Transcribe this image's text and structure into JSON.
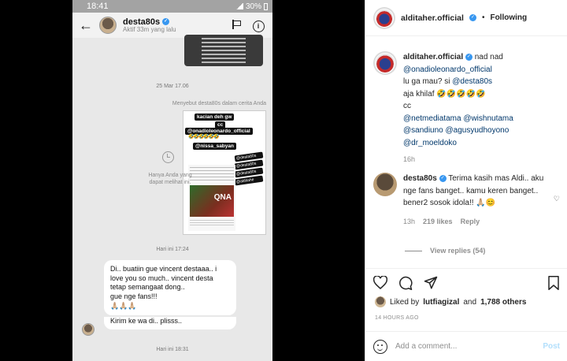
{
  "phone": {
    "time": "18:41",
    "battery": "30%",
    "dm_user": "desta80s",
    "dm_active": "Aktif 33m yang lalu",
    "stamp_1": "25 Mar 17.06",
    "mention_caption": "Menyebut desta80s dalam cerita Anda",
    "only_you": "Hanya Anda yang dapat melihat ini.",
    "story_tags": [
      "kacian deh gw",
      "cc",
      "@onadioleonardo_official",
      "@nissa_sabyan"
    ],
    "story_emoji": "🤣🤣🤣🤣🤣🤣",
    "story_side_tags": [
      "@desta80s",
      "@desta80s",
      "@desta80s",
      "@alditahe"
    ],
    "story_image_text": "QNA",
    "stamp_2": "Hari ini 17:24",
    "message_lines": [
      "Di.. buatiin gue vincent destaaa.. i",
      "love you so much.. vincent desta",
      "tetap semangaat dong..",
      "gue nge fans!!!"
    ],
    "message_hands": "🙏🏼🙏🏼🙏🏼",
    "message_2": "Kirim ke wa di.. plisss..",
    "stamp_3": "Hari ini 18:31"
  },
  "ig": {
    "post_user": "alditaher.official",
    "following": "Following",
    "caption": {
      "user": "alditaher.official",
      "line1": "nad nad",
      "mention1": "@onadioleonardo_official",
      "line2": "lu ga mau? si",
      "mention2": "@desta80s",
      "line3": "aja khilaf 🤣🤣🤣🤣🤣",
      "cc": "cc",
      "mentions": [
        "@netmediatama",
        "@wishnutama",
        "@sandiuno",
        "@agusyudhoyono",
        "@dr_moeldoko"
      ],
      "time": "16h"
    },
    "comment": {
      "user": "desta80s",
      "text": "Terima kasih mas Aldi.. aku nge fans banget.. kamu keren banget.. bener2 sosok idola!! 🙏🏼😊",
      "time": "13h",
      "likes": "219 likes",
      "reply": "Reply"
    },
    "view_replies": "View replies (54)",
    "liked_by_prefix": "Liked by",
    "liked_by_user": "lutfiagizal",
    "liked_by_and": "and",
    "liked_by_count": "1,788 others",
    "ago": "14 HOURS AGO",
    "add_comment_placeholder": "Add a comment...",
    "post_button": "Post"
  },
  "colors": {
    "verified": "#3897f0",
    "link": "#00376b",
    "post_disabled": "#b2dffc"
  }
}
